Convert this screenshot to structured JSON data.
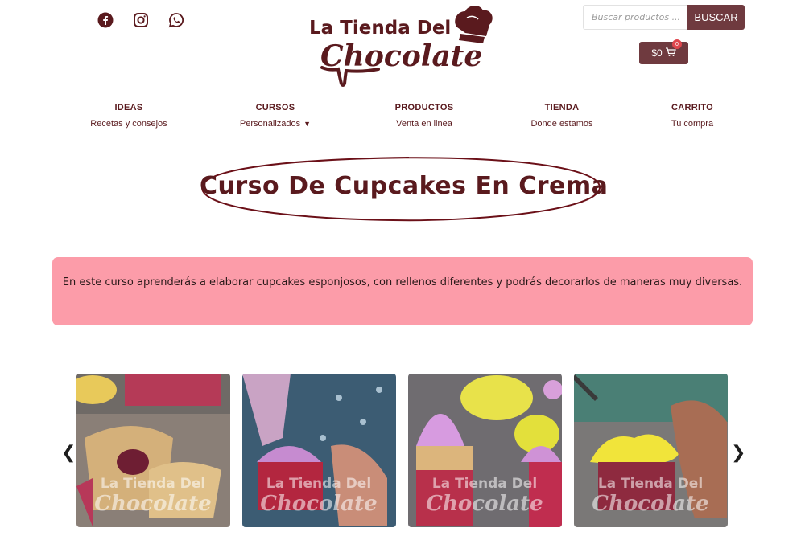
{
  "header": {
    "social_icons": [
      "facebook-icon",
      "instagram-icon",
      "whatsapp-icon"
    ],
    "logo": {
      "line1": "La Tienda Del",
      "line2": "Chocolate"
    },
    "search": {
      "placeholder": "Buscar productos ...",
      "button_label": "BUSCAR"
    },
    "cart": {
      "amount": "$0",
      "count": "0"
    }
  },
  "nav": [
    {
      "label": "IDEAS",
      "sub": "Recetas y consejos"
    },
    {
      "label": "CURSOS",
      "sub": "Personalizados"
    },
    {
      "label": "PRODUCTOS",
      "sub": "Venta en linea"
    },
    {
      "label": "TIENDA",
      "sub": "Donde estamos"
    },
    {
      "label": "CARRITO",
      "sub": "Tu compra"
    }
  ],
  "page": {
    "title": "Curso De Cupcakes En Crema",
    "description": "En este curso aprenderás a elaborar cupcakes esponjosos, con rellenos diferentes y podrás decorarlos de maneras muy diversas."
  },
  "carousel": {
    "watermark_line1": "La Tienda Del",
    "watermark_line2": "Chocolate"
  },
  "colors": {
    "brand": "#5a1a1e",
    "button": "#6f3a3f",
    "banner": "#fc9ca9",
    "badge": "#e0464d"
  }
}
